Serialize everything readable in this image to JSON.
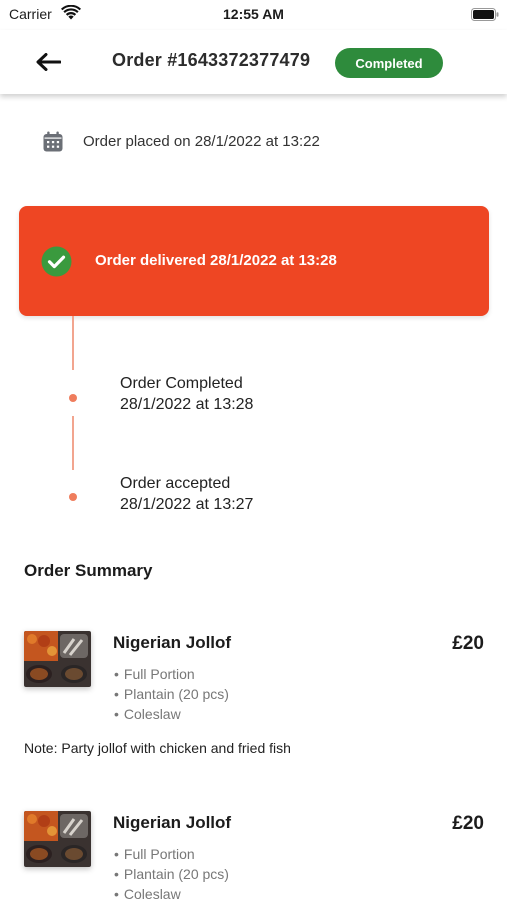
{
  "status_bar": {
    "carrier": "Carrier",
    "time": "12:55 AM"
  },
  "header": {
    "order_title": "Order #1643372377479",
    "status_badge": "Completed",
    "badge_color": "#2e8b3c"
  },
  "placed": {
    "text": "Order placed on 28/1/2022 at 13:22",
    "icon": "calendar-icon"
  },
  "delivered": {
    "text": "Order delivered 28/1/2022 at 13:28",
    "icon": "check-icon",
    "color": "#ee4623"
  },
  "timeline": [
    {
      "title": "Order Completed",
      "time": "28/1/2022 at 13:28"
    },
    {
      "title": "Order accepted",
      "time": "28/1/2022 at 13:27"
    }
  ],
  "summary": {
    "title": "Order Summary",
    "items": [
      {
        "name": "Nigerian Jollof",
        "price": "£20",
        "options": [
          "Full Portion",
          "Plantain (20 pcs)",
          "Coleslaw"
        ],
        "note": "Note: Party jollof with chicken and fried fish"
      },
      {
        "name": "Nigerian Jollof",
        "price": "£20",
        "options": [
          "Full Portion",
          "Plantain (20 pcs)",
          "Coleslaw"
        ]
      }
    ]
  }
}
